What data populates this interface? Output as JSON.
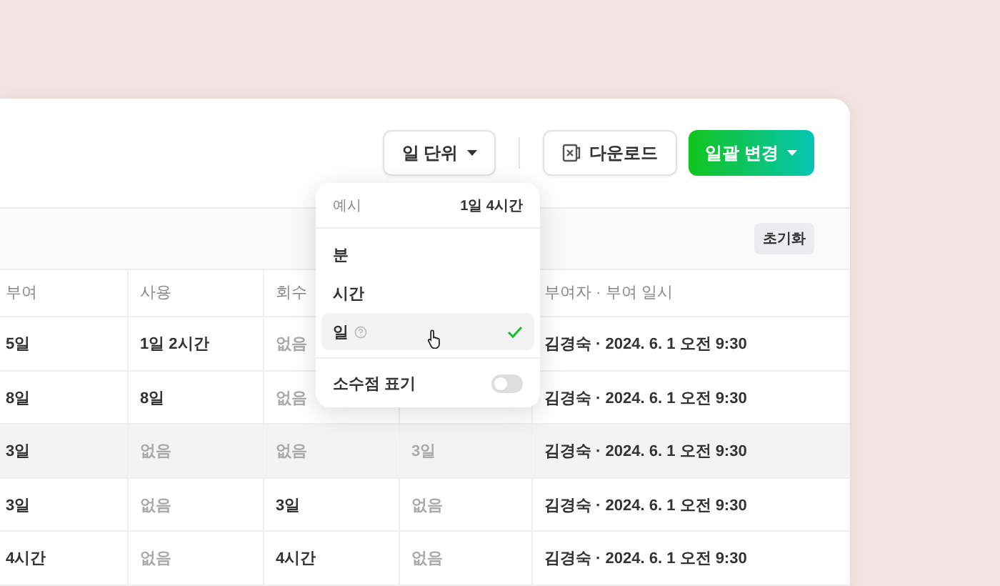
{
  "toolbar": {
    "unit_button": "일 단위",
    "download_button": "다운로드",
    "bulk_button": "일괄 변경"
  },
  "filter_bar": {
    "reset_button": "초기화"
  },
  "table": {
    "columns": [
      {
        "label": "부여"
      },
      {
        "label": "사용"
      },
      {
        "label": "회수"
      },
      null,
      {
        "label": "부여자 · 부여 일시"
      }
    ],
    "rows": [
      {
        "hovered": false,
        "cells": [
          {
            "text": "5일",
            "muted": false
          },
          {
            "text": "1일 2시간",
            "muted": false
          },
          {
            "text": "없음",
            "muted": true
          },
          null,
          {
            "text": "김경숙 · 2024. 6. 1 오전 9:30",
            "muted": false
          }
        ]
      },
      {
        "hovered": false,
        "cells": [
          {
            "text": "8일",
            "muted": false
          },
          {
            "text": "8일",
            "muted": false
          },
          {
            "text": "없음",
            "muted": true
          },
          null,
          {
            "text": "김경숙 · 2024. 6. 1 오전 9:30",
            "muted": false
          }
        ]
      },
      {
        "hovered": true,
        "cells": [
          {
            "text": "3일",
            "muted": false
          },
          {
            "text": "없음",
            "muted": true
          },
          {
            "text": "없음",
            "muted": true
          },
          {
            "text": "3일",
            "muted": true
          },
          {
            "text": "김경숙 · 2024. 6. 1 오전 9:30",
            "muted": false
          }
        ]
      },
      {
        "hovered": false,
        "cells": [
          {
            "text": "3일",
            "muted": false
          },
          {
            "text": "없음",
            "muted": true
          },
          {
            "text": "3일",
            "muted": false
          },
          {
            "text": "없음",
            "muted": true
          },
          {
            "text": "김경숙 · 2024. 6. 1 오전 9:30",
            "muted": false
          }
        ]
      },
      {
        "hovered": false,
        "cells": [
          {
            "text": "4시간",
            "muted": false
          },
          {
            "text": "없음",
            "muted": true
          },
          {
            "text": "4시간",
            "muted": false
          },
          {
            "text": "없음",
            "muted": true
          },
          {
            "text": "김경숙 · 2024. 6. 1 오전 9:30",
            "muted": false
          }
        ]
      }
    ]
  },
  "unit_menu": {
    "example_label": "예시",
    "example_value": "1일 4시간",
    "options": [
      {
        "label": "분",
        "selected": false,
        "help": false
      },
      {
        "label": "시간",
        "selected": false,
        "help": false
      },
      {
        "label": "일",
        "selected": true,
        "help": true
      }
    ],
    "decimal_toggle": {
      "label": "소수점 표기",
      "on": false
    }
  }
}
